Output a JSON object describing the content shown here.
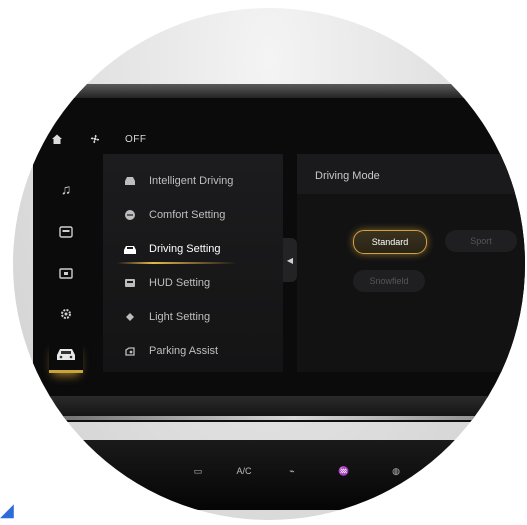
{
  "statusbar": {
    "home_icon": "home-icon",
    "fan_icon": "fan-icon",
    "fan_status": "OFF"
  },
  "rail": {
    "items": [
      {
        "icon": "music-note-icon"
      },
      {
        "icon": "media-icon"
      },
      {
        "icon": "display-icon"
      },
      {
        "icon": "settings-gear-icon"
      },
      {
        "icon": "car-icon",
        "active": true
      }
    ]
  },
  "menu": {
    "items": [
      {
        "label": "Intelligent Driving",
        "icon": "car-assist-icon"
      },
      {
        "label": "Comfort Setting",
        "icon": "comfort-icon"
      },
      {
        "label": "Driving Setting",
        "icon": "steering-icon",
        "active": true
      },
      {
        "label": "HUD Setting",
        "icon": "hud-icon"
      },
      {
        "label": "Light Setting",
        "icon": "light-icon"
      },
      {
        "label": "Parking Assist",
        "icon": "parking-icon"
      }
    ]
  },
  "panel": {
    "title": "Driving Mode",
    "modes": [
      {
        "label": "Standard",
        "selected": true
      },
      {
        "label": "Sport",
        "selected": false
      },
      {
        "label": "Snowfield",
        "selected": false
      }
    ]
  },
  "controls": {
    "ac_label": "A/C"
  },
  "colors": {
    "accent": "#d2a23e",
    "screen_bg": "#0b0b0c"
  }
}
